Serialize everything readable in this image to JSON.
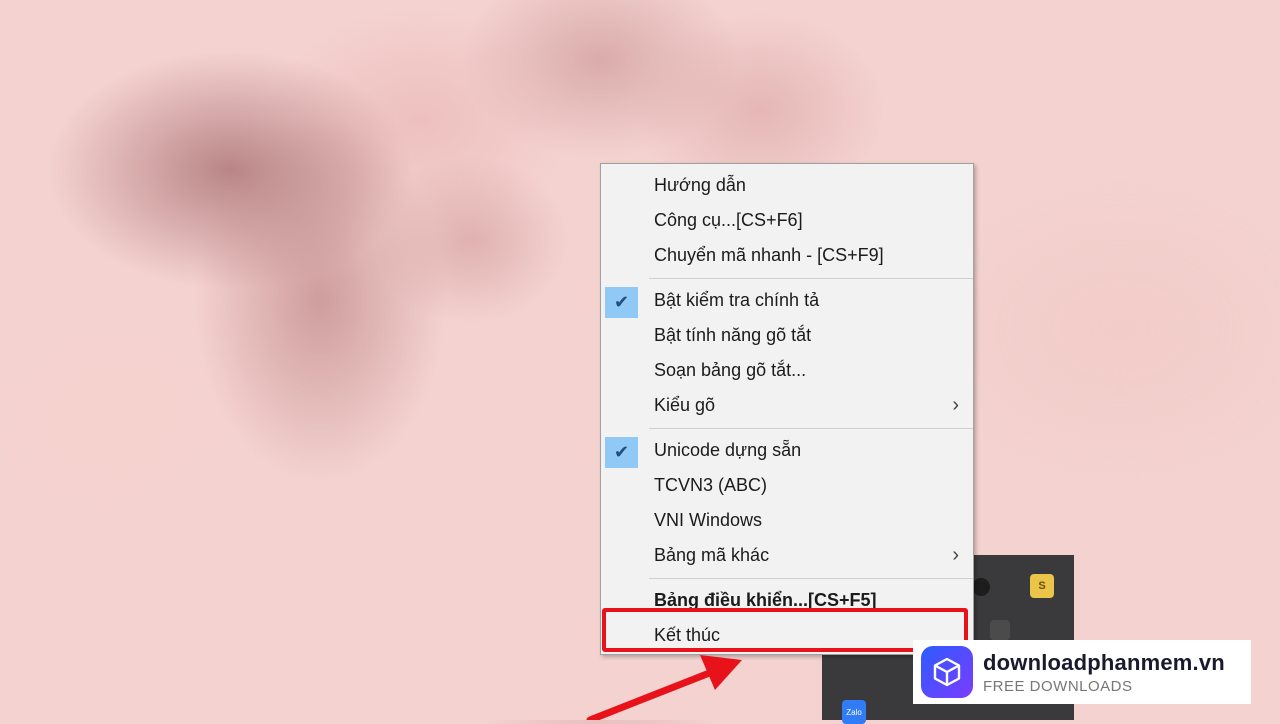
{
  "menu": {
    "groups": [
      [
        {
          "label": "Hướng dẫn"
        },
        {
          "label": "Công cụ...[CS+F6]"
        },
        {
          "label": "Chuyển mã nhanh - [CS+F9]"
        }
      ],
      [
        {
          "label": "Bật kiểm tra chính tả",
          "checked": true
        },
        {
          "label": "Bật tính năng gõ tắt"
        },
        {
          "label": "Soạn bảng gõ tắt..."
        },
        {
          "label": "Kiểu gõ",
          "submenu": true
        }
      ],
      [
        {
          "label": "Unicode dựng sẵn",
          "checked": true
        },
        {
          "label": "TCVN3 (ABC)"
        },
        {
          "label": "VNI Windows"
        },
        {
          "label": "Bảng mã khác",
          "submenu": true
        }
      ],
      [
        {
          "label": "Bảng điều khiển...[CS+F5]",
          "bold": true
        },
        {
          "label": "Kết thúc",
          "highlighted": true
        }
      ]
    ],
    "check_icon": "checkmark-icon",
    "submenu_icon": "chevron-right-icon"
  },
  "tray": {
    "zalo_label": "Zalo",
    "yellow_icon": "S"
  },
  "watermark": {
    "title": "downloadphanmem.vn",
    "subtitle": "FREE DOWNLOADS"
  },
  "colors": {
    "highlight": "#e8131a",
    "check_bg": "#90c8f6",
    "menu_bg": "#f2f2f2"
  }
}
